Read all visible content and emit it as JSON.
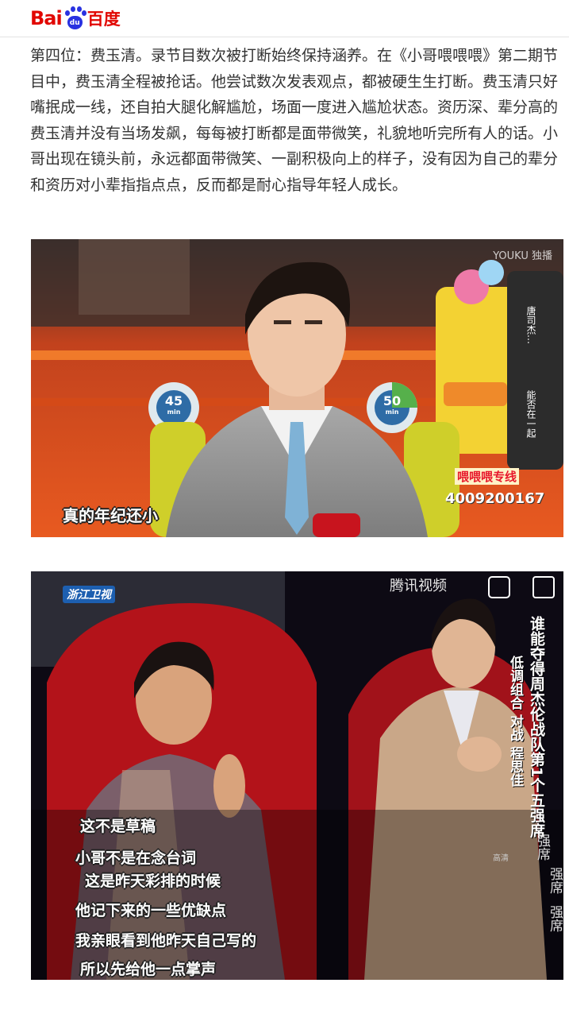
{
  "header": {
    "logo_bai": "Bai",
    "logo_du": "du",
    "logo_cn": "百度"
  },
  "article": {
    "paragraph": "第四位：费玉清。录节目数次被打断始终保持涵养。在《小哥喂喂喂》第二期节目中，费玉清全程被抢话。他尝试数次发表观点，都被硬生生打断。费玉清只好嘴抿成一线，还自拍大腿化解尴尬，场面一度进入尴尬状态。资历深、辈分高的费玉清并没有当场发飙，每每被打断都是面带微笑，礼貌地听完所有人的话。小哥出现在镜头前，永远都面带微笑、一副积极向上的样子，没有因为自己的辈分和资历对小辈指指点点，反而都是耐心指导年轻人成长。"
  },
  "photo1": {
    "subtitle": "真的年纪还小",
    "hotline_label": "喂喂喂专线",
    "hotline_number": "4009200167",
    "watermark": "YOUKU 独播",
    "timer_left_value": "45",
    "timer_left_unit": "min",
    "timer_right_value": "50",
    "timer_right_unit": "min",
    "side_caption_a": "唐司杰…",
    "side_caption_b": "能否在一起"
  },
  "photo2": {
    "channel_logo": "浙江卫视",
    "tencent_logo": "腾讯视频",
    "side_title": "谁能夺得周杰伦战队第1个五强席",
    "side_sub": "低调组合 对战 程思佳",
    "repeat_word": "强席",
    "hd_badge": "高清",
    "subtitles": [
      "这不是草稿",
      "小哥不是在念台词",
      "这是昨天彩排的时候",
      "他记下来的一些优缺点",
      "我亲眼看到他昨天自己写的",
      "所以先给他一点掌声"
    ]
  },
  "colors": {
    "brand_red": "#e10601",
    "brand_blue": "#2932e1",
    "text": "#333333",
    "hotline_red": "#e8192c"
  }
}
